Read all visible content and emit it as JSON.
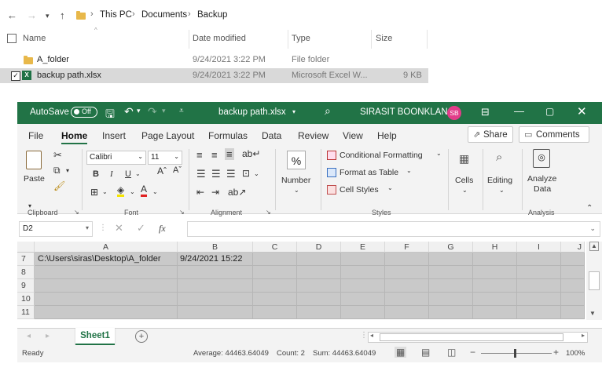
{
  "explorer": {
    "breadcrumb": [
      "This PC",
      "Documents",
      "Backup"
    ],
    "columns": {
      "name": "Name",
      "date": "Date modified",
      "type": "Type",
      "size": "Size"
    },
    "files": [
      {
        "name": "A_folder",
        "date": "9/24/2021 3:22 PM",
        "type": "File folder",
        "size": "",
        "icon": "folder-icon"
      },
      {
        "name": "backup path.xlsx",
        "date": "9/24/2021 3:22 PM",
        "type": "Microsoft Excel W...",
        "size": "9 KB",
        "icon": "excel-file-icon",
        "selected": true
      }
    ]
  },
  "excel": {
    "titlebar": {
      "autosave": "AutoSave",
      "autosave_state": "Off",
      "filename": "backup path.xlsx",
      "user": "SIRASIT BOONKLANG",
      "initials": "SB"
    },
    "menu": {
      "tabs": [
        "File",
        "Home",
        "Insert",
        "Page Layout",
        "Formulas",
        "Data",
        "Review",
        "View",
        "Help"
      ],
      "active": "Home",
      "share": "Share",
      "comments": "Comments"
    },
    "ribbon": {
      "paste": "Paste",
      "font_name": "Calibri",
      "font_size": "11",
      "bold": "B",
      "italic": "I",
      "underline": "U",
      "number": "Number",
      "conditional_formatting": "Conditional Formatting",
      "format_as_table": "Format as Table",
      "cell_styles": "Cell Styles",
      "cells": "Cells",
      "editing": "Editing",
      "analyze_data": "Analyze Data",
      "analyze_data_l1": "Analyze",
      "analyze_data_l2": "Data",
      "groups": {
        "clipboard": "Clipboard",
        "font": "Font",
        "alignment": "Alignment",
        "styles": "Styles",
        "analysis": "Analysis"
      }
    },
    "formula_bar": {
      "name_box": "D2",
      "fx": "fx",
      "content": ""
    },
    "columns": [
      "A",
      "B",
      "C",
      "D",
      "E",
      "F",
      "G",
      "H",
      "I",
      "J"
    ],
    "rows": [
      {
        "num": "7",
        "a": "C:\\Users\\siras\\Desktop\\A_folder",
        "b": "9/24/2021 15:22"
      },
      {
        "num": "8",
        "a": "",
        "b": ""
      },
      {
        "num": "9",
        "a": "",
        "b": ""
      },
      {
        "num": "10",
        "a": "",
        "b": ""
      },
      {
        "num": "11",
        "a": "",
        "b": ""
      }
    ],
    "sheet_tab": "Sheet1",
    "status": {
      "ready": "Ready",
      "average": "Average: 44463.64049",
      "count": "Count: 2",
      "sum": "Sum: 44463.64049",
      "zoom": "100%"
    }
  }
}
